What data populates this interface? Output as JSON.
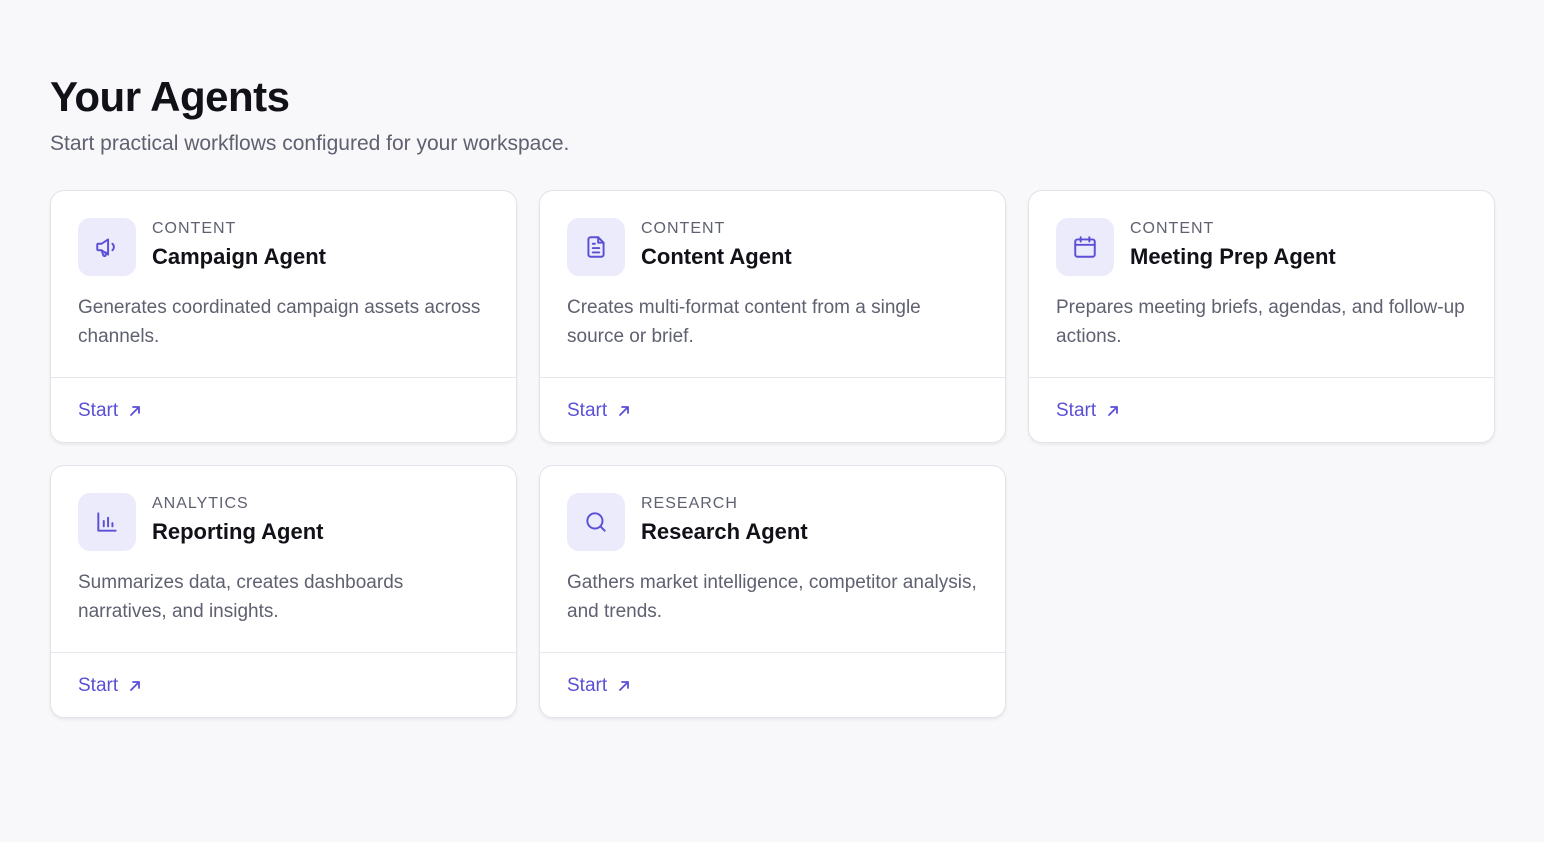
{
  "page": {
    "title": "Your Agents",
    "subtitle": "Start practical workflows configured for your workspace."
  },
  "agents": [
    {
      "category": "CONTENT",
      "name": "Campaign Agent",
      "description": "Generates coordinated campaign assets across channels.",
      "icon": "megaphone-icon",
      "action": "Start"
    },
    {
      "category": "CONTENT",
      "name": "Content Agent",
      "description": "Creates multi-format content from a single source or brief.",
      "icon": "document-icon",
      "action": "Start"
    },
    {
      "category": "CONTENT",
      "name": "Meeting Prep Agent",
      "description": "Prepares meeting briefs, agendas, and follow-up actions.",
      "icon": "calendar-icon",
      "action": "Start"
    },
    {
      "category": "ANALYTICS",
      "name": "Reporting Agent",
      "description": "Summarizes data, creates dashboards narratives, and insights.",
      "icon": "bar-chart-icon",
      "action": "Start"
    },
    {
      "category": "RESEARCH",
      "name": "Research Agent",
      "description": "Gathers market intelligence, competitor analysis, and trends.",
      "icon": "search-icon",
      "action": "Start"
    }
  ],
  "colors": {
    "accent": "#5a4fd6",
    "icon_bg": "#ecebfb",
    "page_bg": "#f8f8fa"
  }
}
